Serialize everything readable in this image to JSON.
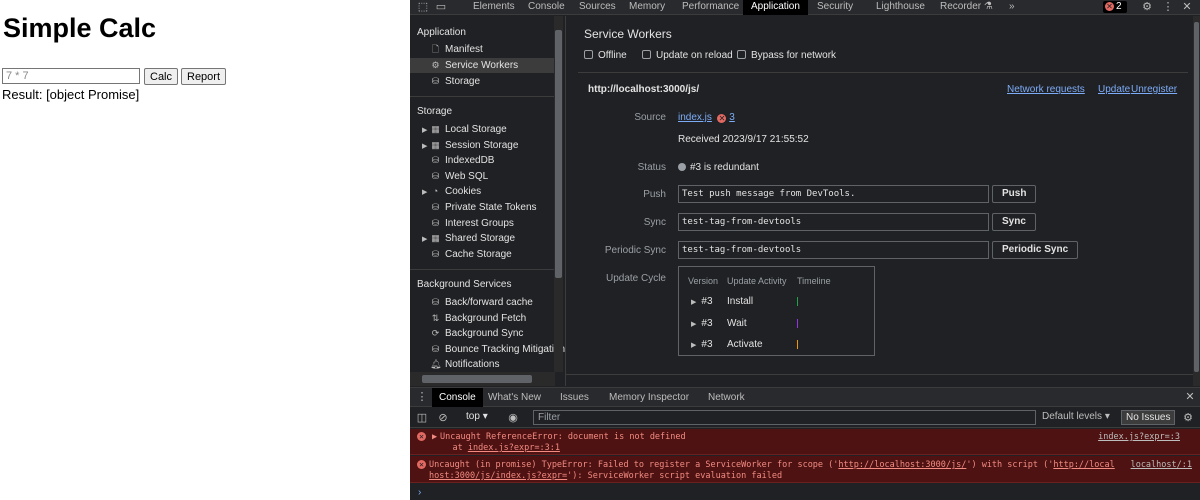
{
  "page": {
    "title": "Simple Calc",
    "input_value": "",
    "input_placeholder": "7 * 7",
    "calc_label": "Calc",
    "report_label": "Report",
    "result": "Result: [object Promise]"
  },
  "devtools": {
    "top_tabs": [
      "Elements",
      "Console",
      "Sources",
      "Memory",
      "Performance",
      "Application",
      "Security",
      "Lighthouse",
      "Recorder"
    ],
    "active_tab": "Application",
    "recorder_icon": "flask-icon",
    "more_tabs": "»",
    "error_count": "2",
    "sidebar": {
      "application_header": "Application",
      "application_items": [
        "Manifest",
        "Service Workers",
        "Storage"
      ],
      "storage_header": "Storage",
      "storage_items": [
        "Local Storage",
        "Session Storage",
        "IndexedDB",
        "Web SQL",
        "Cookies",
        "Private State Tokens",
        "Interest Groups",
        "Shared Storage",
        "Cache Storage"
      ],
      "background_header": "Background Services",
      "background_items": [
        "Back/forward cache",
        "Background Fetch",
        "Background Sync",
        "Bounce Tracking Mitigations",
        "Notifications"
      ]
    },
    "service_workers": {
      "title": "Service Workers",
      "options": [
        "Offline",
        "Update on reload",
        "Bypass for network"
      ],
      "scope": "http://localhost:3000/js/",
      "actions": [
        "Network requests",
        "Update",
        "Unregister"
      ],
      "source_label": "Source",
      "source_file": "index.js",
      "source_errors": "3",
      "received": "Received 2023/9/17 21:55:52",
      "status_label": "Status",
      "status": "#3 is redundant",
      "push_label": "Push",
      "push_value": "Test push message from DevTools.",
      "push_button": "Push",
      "sync_label": "Sync",
      "sync_value": "test-tag-from-devtools",
      "sync_button": "Sync",
      "periodic_label": "Periodic Sync",
      "periodic_value": "test-tag-from-devtools",
      "periodic_button": "Periodic Sync",
      "cycle_label": "Update Cycle",
      "cycle_headers": [
        "Version",
        "Update Activity",
        "Timeline"
      ],
      "cycle_rows": [
        {
          "version": "#3",
          "activity": "Install",
          "color": "#1ea446"
        },
        {
          "version": "#3",
          "activity": "Wait",
          "color": "#9334e6"
        },
        {
          "version": "#3",
          "activity": "Activate",
          "color": "#f29900"
        }
      ]
    },
    "drawer": {
      "tabs": [
        "Console",
        "What's New",
        "Issues",
        "Memory Inspector",
        "Network"
      ],
      "active_tab": "Console",
      "context": "top",
      "filter_placeholder": "Filter",
      "levels": "Default levels",
      "no_issues": "No Issues",
      "errors": [
        {
          "text": "Uncaught ReferenceError: document is not defined",
          "at_prefix": "    at ",
          "at_link": "index.js?expr=:3:1",
          "source": "index.js?expr=:3"
        },
        {
          "line1_a": "Uncaught (in promise) TypeError: Failed to register a ServiceWorker for scope ('",
          "line1_link1": "http://localhost:3000/js/",
          "line1_b": "') with script ('",
          "line1_link2": "http://local",
          "line2_link": "host:3000/js/index.js?expr=",
          "line2_rest": "'): ServiceWorker script evaluation failed",
          "source": "localhost/:1"
        }
      ],
      "prompt": "›"
    }
  }
}
